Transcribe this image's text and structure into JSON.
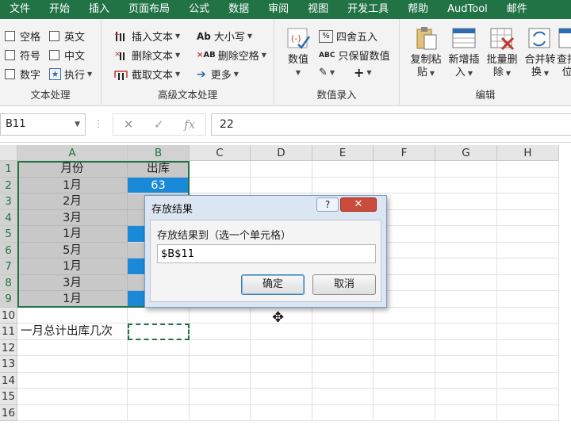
{
  "menu": {
    "tabs": [
      "文件",
      "开始",
      "插入",
      "页面布局",
      "公式",
      "数据",
      "审阅",
      "视图",
      "开发工具",
      "帮助",
      "AudTool",
      "邮件"
    ]
  },
  "ribbon": {
    "text_processing": {
      "label": "文本处理",
      "checks": [
        "空格",
        "英文",
        "符号",
        "中文",
        "数字"
      ],
      "execute": "执行"
    },
    "advanced_text": {
      "label": "高级文本处理",
      "insert_text": "插入文本",
      "delete_text": "删除文本",
      "extract_text": "截取文本",
      "case_label": "大小写",
      "case_icon_text": "Ab",
      "remove_spaces": "删除空格",
      "remove_spaces_icon_text": "AB",
      "more": "更多"
    },
    "number_entry": {
      "label": "数值录入",
      "value_btn": "数值",
      "round": "四舍五入",
      "keep_value": "只保留数值",
      "keep_value_icon_text": "ABC"
    },
    "edit": {
      "label": "编辑",
      "copy_paste": [
        "复制粘",
        "贴"
      ],
      "insert_new": [
        "新增插",
        "入"
      ],
      "batch_delete": [
        "批量删",
        "除"
      ],
      "merge_convert": [
        "合并转",
        "换"
      ],
      "find_locate": [
        "查找",
        "位"
      ]
    }
  },
  "formula_bar": {
    "name_box": "B11",
    "value": "22"
  },
  "sheet": {
    "columns": [
      "A",
      "B",
      "C",
      "D",
      "E",
      "F",
      "G",
      "H"
    ],
    "rows": [
      "1",
      "2",
      "3",
      "4",
      "5",
      "6",
      "7",
      "8",
      "9",
      "10",
      "11",
      "12",
      "13",
      "14",
      "15",
      "16"
    ],
    "a_values": [
      "月份",
      "1月",
      "2月",
      "3月",
      "1月",
      "5月",
      "1月",
      "3月",
      "1月"
    ],
    "b_header": "出库",
    "b2_value": "63",
    "a11_text": "一月总计出库几次"
  },
  "dialog": {
    "title": "存放结果",
    "help": "?",
    "close": "✕",
    "prompt": "存放结果到（选一个单元格）",
    "input_value": "$B$11",
    "ok": "确定",
    "cancel": "取消"
  },
  "colors": {
    "menubar": "#217346",
    "selection_border": "#217346",
    "highlight_blue": "#1a8ad8",
    "selection_grey": "#c8c8c8"
  }
}
